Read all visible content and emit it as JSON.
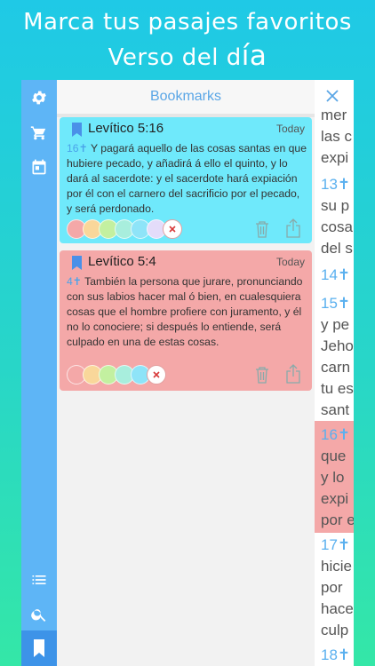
{
  "promo": {
    "line1": "Marca tus pasajes favoritos",
    "line2a": "Verso del d",
    "line2b": "ía"
  },
  "sidebar": {
    "items": [
      {
        "icon": "gear-icon",
        "label": "Settings"
      },
      {
        "icon": "cart-icon",
        "label": "Store"
      },
      {
        "icon": "calendar-icon",
        "label": "Calendar"
      },
      {
        "icon": "list-icon",
        "label": "Index"
      },
      {
        "icon": "search-icon",
        "label": "Search"
      },
      {
        "icon": "bookmark-icon",
        "label": "Bookmarks",
        "active": true
      }
    ]
  },
  "panel": {
    "title": "Bookmarks"
  },
  "bookmarks": [
    {
      "ref": "Levítico 5:16",
      "date": "Today",
      "verse_num": "16",
      "text": "Y pagará aquello de las cosas santas en que hubiere pecado, y añadirá á ello el quinto, y lo dará al sacerdote: y el sacerdote hará expiación por él con el carnero del sacrificio por el pecado, y será perdonado.",
      "color": "#6fe9fb"
    },
    {
      "ref": "Levítico 5:4",
      "date": "Today",
      "verse_num": "4",
      "text": "También la persona que jurare, pronunciando con sus labios hacer mal ó bien, en cualesquiera cosas que el hombre profiere con juramento, y él no lo conociere; si después lo entiende, será culpado en una de estas cosas.",
      "color": "#f4a8a8"
    }
  ],
  "swatch_colors": [
    "#f4a8a8",
    "#f9d79a",
    "#c3f0a0",
    "#a8eedd",
    "#8ee4f8",
    "#e4dcfa"
  ],
  "reader": {
    "lines": [
      {
        "num": "",
        "text": "mer"
      },
      {
        "num": "",
        "text": "las c"
      },
      {
        "num": "",
        "text": "expi"
      },
      {
        "num": "13",
        "text": ""
      },
      {
        "num": "",
        "text": "su p"
      },
      {
        "num": "",
        "text": "cosa"
      },
      {
        "num": "",
        "text": "del s"
      },
      {
        "num": "14",
        "text": ""
      },
      {
        "num": "15",
        "text": ""
      },
      {
        "num": "",
        "text": "y pe"
      },
      {
        "num": "",
        "text": "Jeho"
      },
      {
        "num": "",
        "text": "carn"
      },
      {
        "num": "",
        "text": "tu es"
      },
      {
        "num": "",
        "text": "sant"
      },
      {
        "num": "16",
        "text": ""
      },
      {
        "num": "",
        "text": "que"
      },
      {
        "num": "",
        "text": "y lo"
      },
      {
        "num": "",
        "text": "expi"
      },
      {
        "num": "",
        "text": "por e"
      },
      {
        "num": "17",
        "text": ""
      },
      {
        "num": "",
        "text": "hicie"
      },
      {
        "num": "",
        "text": "por"
      },
      {
        "num": "",
        "text": "hace"
      },
      {
        "num": "",
        "text": "culp"
      },
      {
        "num": "18",
        "text": ""
      }
    ]
  }
}
